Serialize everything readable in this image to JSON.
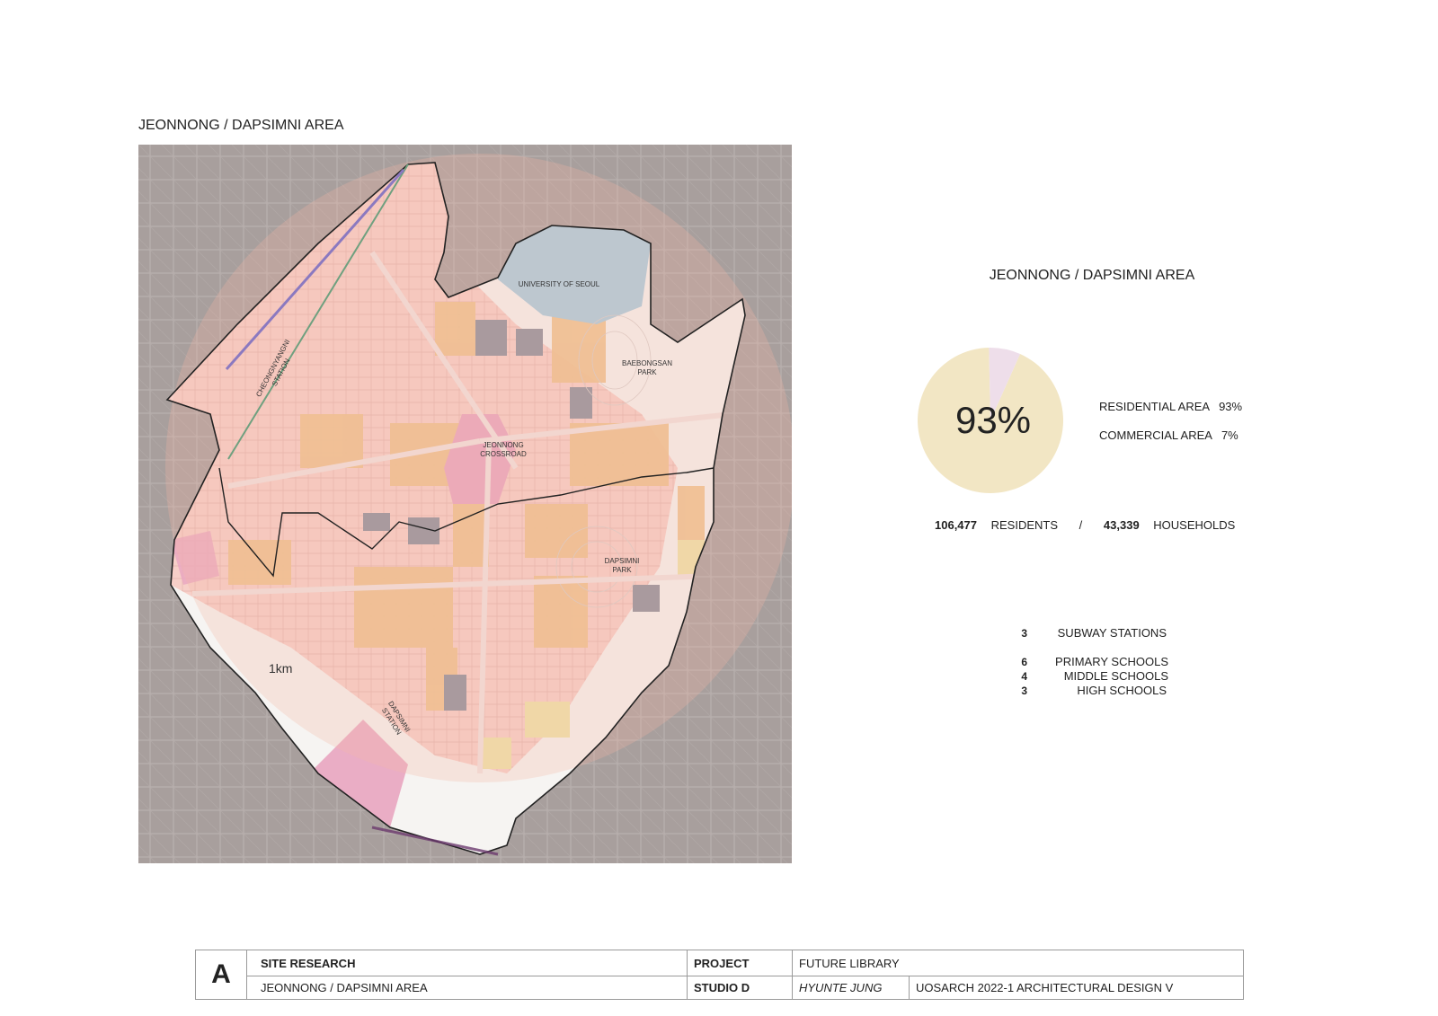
{
  "map": {
    "title": "JEONNONG / DAPSIMNI AREA",
    "radius_label": "1km",
    "labels": {
      "university": "UNIVERSITY OF SEOUL",
      "baebongsan_1": "BAEBONGSAN",
      "baebongsan_2": "PARK",
      "cheongnyangni_1": "CHEONGNYANGNI",
      "cheongnyangni_2": "STATION",
      "jeonnong_1": "JEONNONG",
      "jeonnong_2": "CROSSROAD",
      "dapsimni_park_1": "DAPSIMNI",
      "dapsimni_park_2": "PARK",
      "dapsimni_station_1": "DAPSIMNI",
      "dapsimni_station_2": "STATION"
    },
    "colors": {
      "background": "#a89f9d",
      "residential": "#f7cfc8",
      "apartment": "#efc38e",
      "commercial": "#e9a5c0",
      "university": "#a8cde0",
      "school": "#efe3a8",
      "institution": "#8d8f9b",
      "outline": "#222222"
    }
  },
  "stats": {
    "title": "JEONNONG / DAPSIMNI AREA",
    "pie_center_label": "93%",
    "residential_label": "RESIDENTIAL AREA",
    "residential_value": "93%",
    "commercial_label": "COMMERCIAL AREA",
    "commercial_value": "7%",
    "residents_value": "106,477",
    "residents_label": "RESIDENTS",
    "separator": "/",
    "households_value": "43,339",
    "households_label": "HOUSEHOLDS",
    "colors": {
      "residential": "#f2e6c4",
      "commercial": "#eedeea"
    }
  },
  "chart_data": {
    "type": "pie",
    "categories": [
      "RESIDENTIAL AREA",
      "COMMERCIAL AREA"
    ],
    "values": [
      93,
      7
    ],
    "title": ""
  },
  "facilities": [
    {
      "count": "3",
      "label": "SUBWAY STATIONS"
    },
    {
      "count": "6",
      "label": "PRIMARY SCHOOLS"
    },
    {
      "count": "4",
      "label": "MIDDLE SCHOOLS"
    },
    {
      "count": "3",
      "label": "HIGH SCHOOLS"
    }
  ],
  "title_block": {
    "letter": "A",
    "section_label": "SITE RESEARCH",
    "section_value": "JEONNONG / DAPSIMNI AREA",
    "project_label": "PROJECT",
    "project_value": "FUTURE LIBRARY",
    "studio_label": "STUDIO D",
    "author": "HYUNTE JUNG",
    "course": "UOSARCH 2022-1 ARCHITECTURAL DESIGN V"
  }
}
